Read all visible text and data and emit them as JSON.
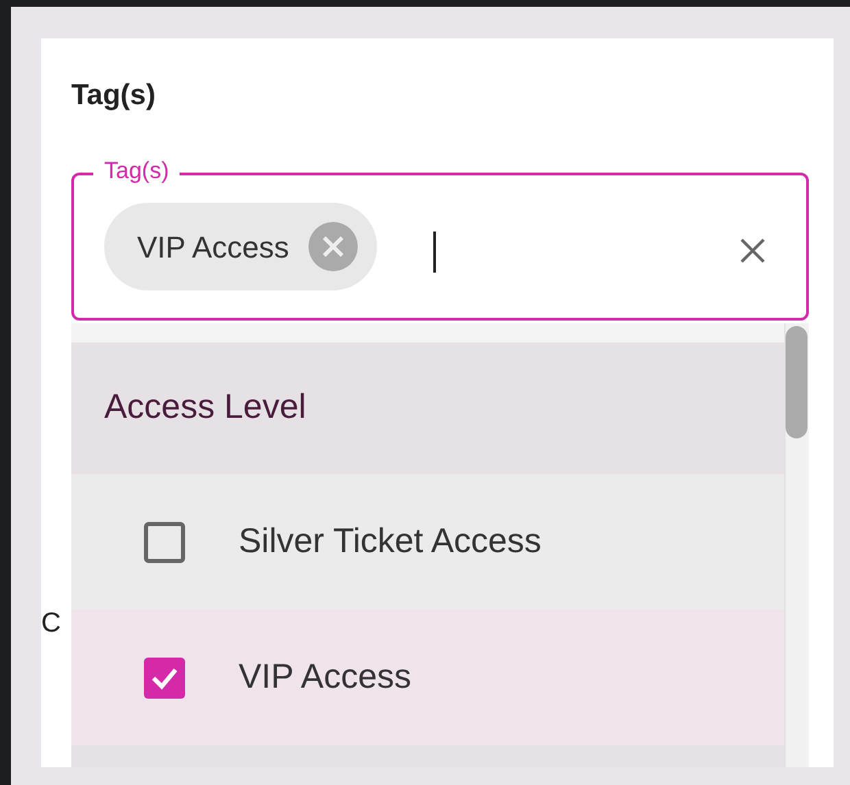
{
  "section_title": "Tag(s)",
  "tag_field": {
    "label": "Tag(s)",
    "focused": true,
    "chips": [
      {
        "label": "VIP Access"
      }
    ]
  },
  "background_text": "C",
  "dropdown": {
    "group": "Access Level",
    "options": [
      {
        "label": "Silver Ticket Access",
        "checked": false
      },
      {
        "label": "VIP Access",
        "checked": true
      }
    ]
  }
}
